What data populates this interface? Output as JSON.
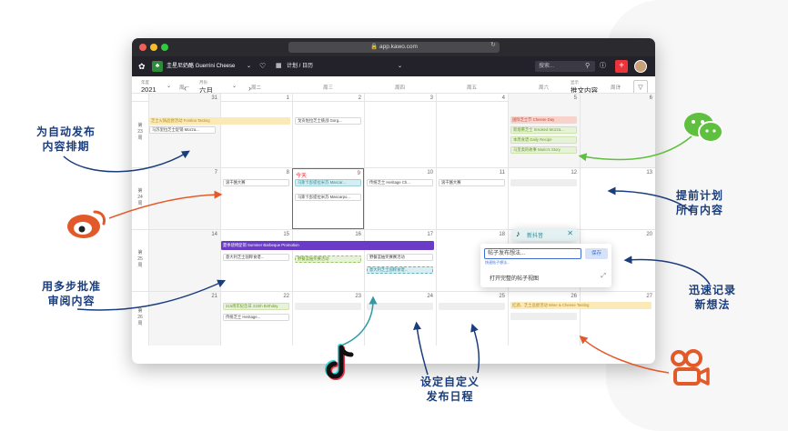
{
  "browser": {
    "url": "app.kawo.com"
  },
  "appbar": {
    "brand_name": "圭星尼奶酪 Guerrini Cheese",
    "view_name": "计划 / 日历",
    "search_placeholder": "搜索..."
  },
  "toolbar": {
    "year_label": "年度",
    "year_value": "2021",
    "month_label": "月份",
    "month_value": "六月",
    "display_label": "显示",
    "display_value": "推文内容"
  },
  "weekdays": [
    "周一",
    "周二",
    "周三",
    "周四",
    "周五",
    "周六",
    "周日"
  ],
  "weeks": [
    {
      "label": [
        "第",
        "23",
        "周"
      ],
      "days": [
        "31",
        "1",
        "2",
        "3",
        "4",
        "5",
        "6"
      ]
    },
    {
      "label": [
        "第",
        "24",
        "周"
      ],
      "days": [
        "7",
        "8",
        "9",
        "10",
        "11",
        "12",
        "13"
      ]
    },
    {
      "label": [
        "第",
        "25",
        "周"
      ],
      "days": [
        "14",
        "15",
        "16",
        "17",
        "18",
        "19",
        "20"
      ]
    },
    {
      "label": [
        "第",
        "26",
        "周"
      ],
      "days": [
        "21",
        "22",
        "23",
        "24",
        "25",
        "26",
        "27"
      ]
    }
  ],
  "today_label": "今天",
  "events": {
    "fontina": "芝士火锅品尝活动 Fontina Tasting",
    "mozza_w1": "马苏里拉芝士促销 Mozza...",
    "gorg": "戈贡佐拉芝士挑战 Gorg...",
    "cheese_day": "国际芝士节 Cheese Day",
    "smoked": "新烟熏芝士 Smoked Mozza...",
    "daily_recipe": "本周食谱 Daily Recipe",
    "mario": "马里奥的故事 Mario's Story",
    "cheese_race": "滚干酪大赛",
    "mascar_1": "马斯卡彭提拉米苏 Mascar...",
    "mascar_2": "马斯卡彭提拉米苏 Mascarpo...",
    "heritage_w2": "传统芝士 Heritage Ch...",
    "cheese_race_2": "滚干酪大赛",
    "bbq": "夏季烧烤促销 Summer Barbeque Promotion",
    "italy_series": "意大利芝士国粹食谱...",
    "picnic": "野餐篮抽奖赛活动",
    "picnic_2": "野餐篮抽奖赛赛活动",
    "italy_series_2": "意大利芝士国粹食谱...",
    "birthday": "215周年纪念日 215th Birthday",
    "heritage_w4": "传统芝士 Heritage...",
    "wine": "红酒、芝士品尝活动 Wine & Cheese Tasting"
  },
  "douyin_chip": {
    "label": "新抖音"
  },
  "quick_popup": {
    "placeholder": "帖子发布想法...",
    "save_label": "保存",
    "hint": "快速帖子想法...",
    "open_full": "打开完整的帖子视图"
  },
  "callouts": {
    "auto_schedule": [
      "为自动发布",
      "内容排期"
    ],
    "plan_ahead": [
      "提前计划",
      "所有内容"
    ],
    "approval": [
      "用多步批准",
      "审阅内容"
    ],
    "quick_record": [
      "迅速记录",
      "新想法"
    ],
    "custom_schedule": [
      "设定自定义",
      "发布日程"
    ]
  },
  "colors": {
    "accent_red": "#e8343a",
    "purple": "#6a3bc7",
    "wechat_green": "#5fbf3f",
    "weibo_orange": "#e35a2a",
    "callout_blue": "#1a3d7c"
  },
  "icons": [
    "wechat-icon",
    "weibo-icon",
    "tiktok-icon",
    "kuaishou-icon"
  ]
}
